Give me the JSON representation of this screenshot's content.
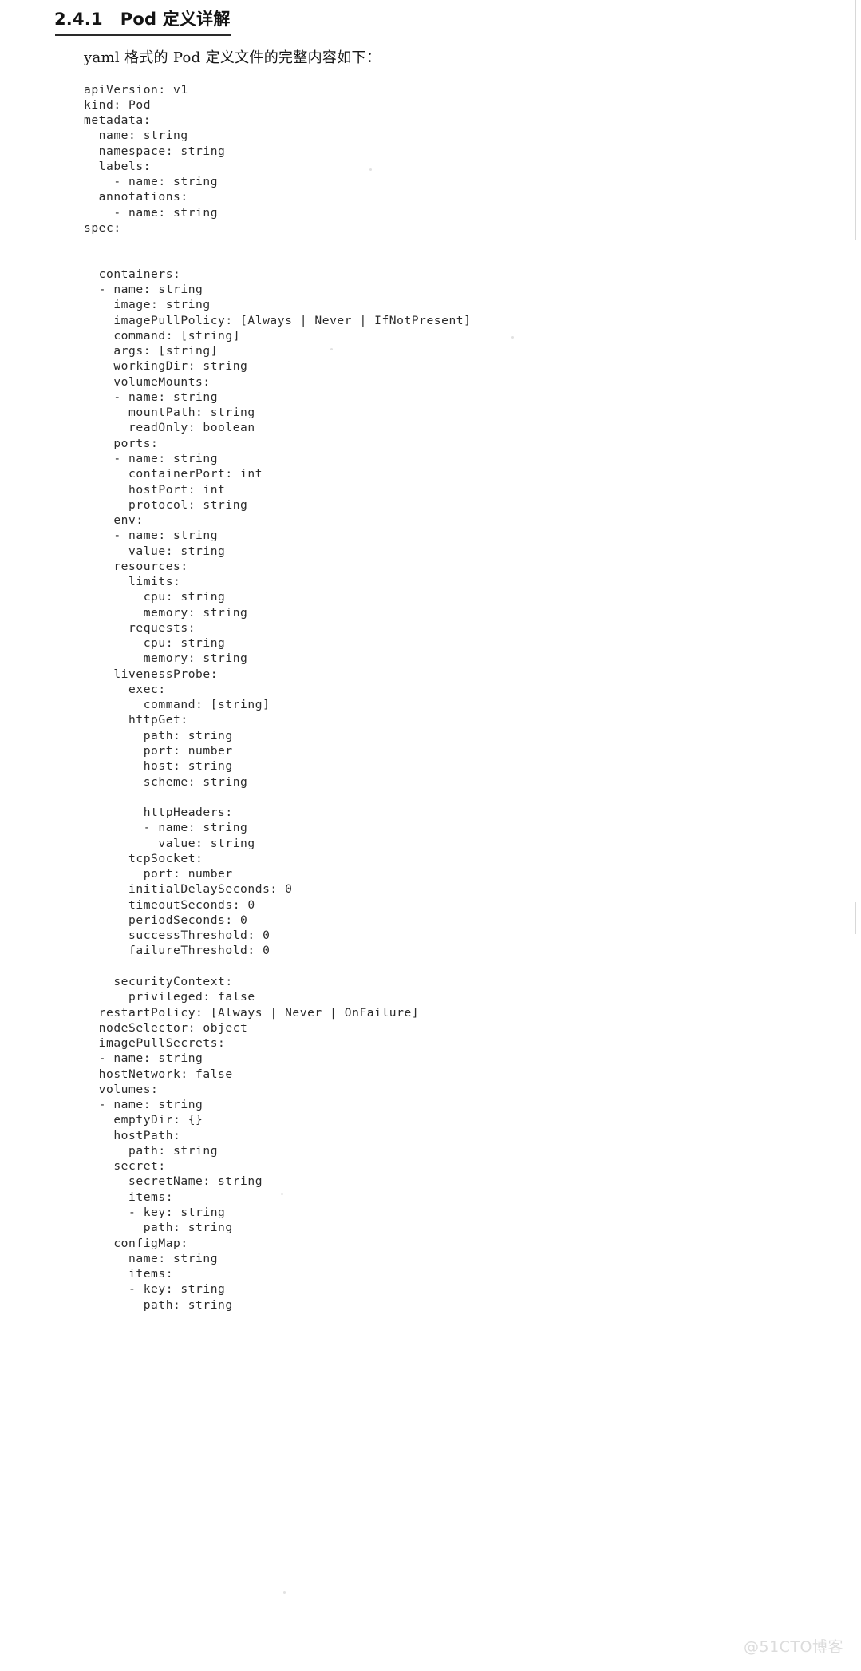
{
  "page": {
    "heading_number": "2.4.1",
    "heading_title": "Pod 定义详解",
    "intro_paragraph": "yaml 格式的 Pod 定义文件的完整内容如下：",
    "watermark": "@51CTO博客",
    "background_color": "#ffffff",
    "text_color": "#1b1b1b",
    "watermark_color": "#dcdcdc"
  },
  "code": {
    "language": "yaml",
    "lines": [
      "apiVersion: v1",
      "kind: Pod",
      "metadata:",
      "  name: string",
      "  namespace: string",
      "  labels:",
      "    - name: string",
      "  annotations:",
      "    - name: string",
      "spec:",
      "",
      "",
      "  containers:",
      "  - name: string",
      "    image: string",
      "    imagePullPolicy: [Always | Never | IfNotPresent]",
      "    command: [string]",
      "    args: [string]",
      "    workingDir: string",
      "    volumeMounts:",
      "    - name: string",
      "      mountPath: string",
      "      readOnly: boolean",
      "    ports:",
      "    - name: string",
      "      containerPort: int",
      "      hostPort: int",
      "      protocol: string",
      "    env:",
      "    - name: string",
      "      value: string",
      "    resources:",
      "      limits:",
      "        cpu: string",
      "        memory: string",
      "      requests:",
      "        cpu: string",
      "        memory: string",
      "    livenessProbe:",
      "      exec:",
      "        command: [string]",
      "      httpGet:",
      "        path: string",
      "        port: number",
      "        host: string",
      "        scheme: string",
      "",
      "        httpHeaders:",
      "        - name: string",
      "          value: string",
      "      tcpSocket:",
      "        port: number",
      "      initialDelaySeconds: 0",
      "      timeoutSeconds: 0",
      "      periodSeconds: 0",
      "      successThreshold: 0",
      "      failureThreshold: 0",
      "",
      "    securityContext:",
      "      privileged: false",
      "  restartPolicy: [Always | Never | OnFailure]",
      "  nodeSelector: object",
      "  imagePullSecrets:",
      "  - name: string",
      "  hostNetwork: false",
      "  volumes:",
      "  - name: string",
      "    emptyDir: {}",
      "    hostPath:",
      "      path: string",
      "    secret:",
      "      secretName: string",
      "      items:",
      "      - key: string",
      "        path: string",
      "    configMap:",
      "      name: string",
      "      items:",
      "      - key: string",
      "        path: string"
    ]
  }
}
